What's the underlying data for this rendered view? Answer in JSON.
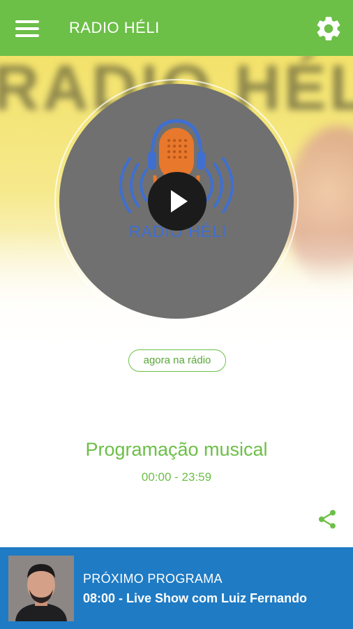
{
  "app": {
    "title": "RADIO HÉLI"
  },
  "hero": {
    "background_text": "RADIO HÉLI",
    "logo_text": "RADIO HÉLI"
  },
  "now_playing": {
    "badge": "agora na rádio",
    "program_name": "Programação musical",
    "program_time": "00:00 - 23:59"
  },
  "next_program": {
    "label": "PRÓXIMO PROGRAMA",
    "title": "08:00 - Live Show com Luiz Fernando"
  },
  "icons": {
    "menu": "menu-icon",
    "settings": "gear-icon",
    "play": "play-icon",
    "share": "share-icon",
    "logo": "microphone-headphones-logo"
  },
  "colors": {
    "primary_green": "#6cbf47",
    "bottom_bar_blue": "#1f7bc4",
    "disc_gray": "#707070",
    "logo_orange": "#e8782c",
    "logo_blue": "#3f6fd0"
  }
}
